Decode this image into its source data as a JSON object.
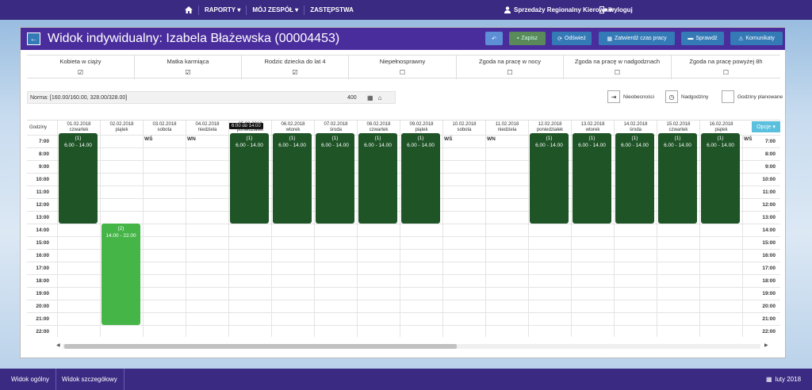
{
  "topnav": {
    "home_icon": "home-icon",
    "items": [
      "RAPORTY",
      "MÓJ ZESPÓŁ",
      "ZASTĘPSTWA"
    ],
    "user": "Sprzedaży Regionalny Kierownik",
    "logout": "wyloguj"
  },
  "header": {
    "title": "Widok indywidualny: Izabela Błażewska (00004453)",
    "buttons": {
      "zapisz": "Zapisz",
      "odswiez": "Odśwież",
      "zatwierdz": "Zatwierdź czas pracy",
      "sprawdz": "Sprawdź",
      "komunikaty": "Komunikaty"
    }
  },
  "attributes": [
    {
      "label": "Kobieta w ciąży",
      "checked": true
    },
    {
      "label": "Matka karmiąca",
      "checked": true
    },
    {
      "label": "Rodzic dziecka do lat 4",
      "checked": true
    },
    {
      "label": "Niepełnosprawny",
      "checked": false
    },
    {
      "label": "Zgoda na pracę w nocy",
      "checked": false
    },
    {
      "label": "Zgoda na pracę w nadgodznach",
      "checked": false
    },
    {
      "label": "Zgoda na pracę powyżej 8h",
      "checked": false
    }
  ],
  "norm": {
    "text": "Norma: [160.00/160.00, 328.00/328.00]",
    "value": "400"
  },
  "legend": {
    "nieobecnosci": "Nieobecności",
    "nadgodziny": "Nadgodziny",
    "planowane": "Godziny planowane"
  },
  "grid": {
    "hours_label": "Godziny",
    "opcje": "Opcje",
    "tooltip": "6:00 do 14:00",
    "hours": [
      "7:00",
      "8:00",
      "9:00",
      "10:00",
      "11:00",
      "12:00",
      "13:00",
      "14:00",
      "15:00",
      "16:00",
      "17:00",
      "18:00",
      "19:00",
      "20:00",
      "21:00",
      "22:00"
    ],
    "days": [
      {
        "date": "01.02.2018",
        "weekday": "czwartek"
      },
      {
        "date": "02.02.2018",
        "weekday": "piątek"
      },
      {
        "date": "03.02.2018",
        "weekday": "sobota"
      },
      {
        "date": "04.02.2018",
        "weekday": "niedziela"
      },
      {
        "date": "05.02.2018",
        "weekday": "poniedziałek"
      },
      {
        "date": "06.02.2018",
        "weekday": "wtorek"
      },
      {
        "date": "07.02.2018",
        "weekday": "środa"
      },
      {
        "date": "08.02.2018",
        "weekday": "czwartek"
      },
      {
        "date": "09.02.2018",
        "weekday": "piątek"
      },
      {
        "date": "10.02.2018",
        "weekday": "sobota"
      },
      {
        "date": "11.02.2018",
        "weekday": "niedziela"
      },
      {
        "date": "12.02.2018",
        "weekday": "poniedziałek"
      },
      {
        "date": "13.02.2018",
        "weekday": "wtorek"
      },
      {
        "date": "14.02.2018",
        "weekday": "środa"
      },
      {
        "date": "15.02.2018",
        "weekday": "czwartek"
      },
      {
        "date": "16.02.2018",
        "weekday": "piątek"
      }
    ],
    "day_markers": [
      {
        "day": 2,
        "label": "WŚ"
      },
      {
        "day": 3,
        "label": "WN"
      },
      {
        "day": 9,
        "label": "WŚ"
      },
      {
        "day": 10,
        "label": "WN"
      },
      {
        "day": 16,
        "label": "WŚ"
      }
    ],
    "shifts": [
      {
        "day": 0,
        "count": "(1)",
        "time": "6.00 - 14.00",
        "start": 6,
        "end": 14,
        "color": "#1f5427"
      },
      {
        "day": 1,
        "count": "(2)",
        "time": "14.00 - 22.00",
        "start": 14,
        "end": 22,
        "color": "#45b548"
      },
      {
        "day": 4,
        "count": "(1)",
        "time": "6.00 - 14.00",
        "start": 6,
        "end": 14,
        "color": "#1f5427"
      },
      {
        "day": 5,
        "count": "(1)",
        "time": "6.00 - 14.00",
        "start": 6,
        "end": 14,
        "color": "#1f5427"
      },
      {
        "day": 6,
        "count": "(1)",
        "time": "6.00 - 14.00",
        "start": 6,
        "end": 14,
        "color": "#1f5427"
      },
      {
        "day": 7,
        "count": "(1)",
        "time": "6.00 - 14.00",
        "start": 6,
        "end": 14,
        "color": "#1f5427"
      },
      {
        "day": 8,
        "count": "(1)",
        "time": "6.00 - 14.00",
        "start": 6,
        "end": 14,
        "color": "#1f5427"
      },
      {
        "day": 11,
        "count": "(1)",
        "time": "6.00 - 14.00",
        "start": 6,
        "end": 14,
        "color": "#1f5427"
      },
      {
        "day": 12,
        "count": "(1)",
        "time": "6.00 - 14.00",
        "start": 6,
        "end": 14,
        "color": "#1f5427"
      },
      {
        "day": 13,
        "count": "(1)",
        "time": "6.00 - 14.00",
        "start": 6,
        "end": 14,
        "color": "#1f5427"
      },
      {
        "day": 14,
        "count": "(1)",
        "time": "6.00 - 14.00",
        "start": 6,
        "end": 14,
        "color": "#1f5427"
      },
      {
        "day": 15,
        "count": "(1)",
        "time": "6.00 - 14.00",
        "start": 6,
        "end": 14,
        "color": "#1f5427"
      }
    ]
  },
  "footer": {
    "tabs": [
      "Widok ogólny",
      "Widok szczegółowy"
    ],
    "date": "luty 2018"
  }
}
